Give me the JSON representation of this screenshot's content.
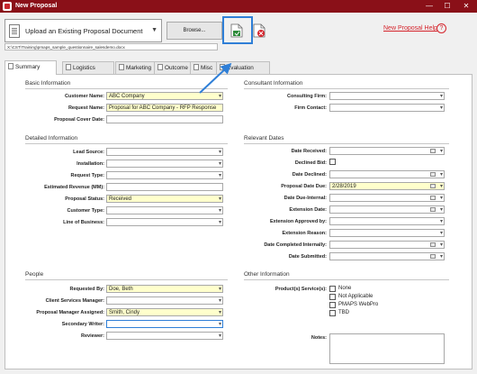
{
  "window": {
    "title": "New Proposal",
    "minimize": "—",
    "maximize": "☐",
    "close": "✕"
  },
  "toolbar": {
    "upload_select": "Upload an Existing Proposal Document",
    "browse_label": "Browse...",
    "file_path": "X:\\CST\\Training\\pmaps_sample_questionnaire_salesdemo.docx",
    "help_label": "New Proposal Help",
    "help_icon": "?"
  },
  "tabs": [
    {
      "label": "Summary",
      "active": true
    },
    {
      "label": "Logistics",
      "active": false
    },
    {
      "label": "Marketing",
      "active": false
    },
    {
      "label": "Outcome",
      "active": false
    },
    {
      "label": "Misc",
      "active": false
    },
    {
      "label": "Evaluation",
      "active": false
    }
  ],
  "basic_information": {
    "title": "Basic Information",
    "fields": [
      {
        "label": "Customer Name:",
        "value": "ABC Company"
      },
      {
        "label": "Request Name:",
        "value": "Proposal for ABC Company - RFP Response"
      },
      {
        "label": "Proposal Cover Date:",
        "value": ""
      }
    ]
  },
  "consultant_information": {
    "title": "Consultant Information",
    "fields": [
      {
        "label": "Consulting Firm:",
        "value": ""
      },
      {
        "label": "Firm Contact:",
        "value": ""
      }
    ]
  },
  "detailed_information": {
    "title": "Detailed Information",
    "fields": [
      {
        "label": "Lead Source:",
        "value": ""
      },
      {
        "label": "Installation:",
        "value": ""
      },
      {
        "label": "Request Type:",
        "value": ""
      },
      {
        "label": "Estimated Revenue (MM):",
        "value": ""
      },
      {
        "label": "Proposal Status:",
        "value": "Received"
      },
      {
        "label": "Customer Type:",
        "value": ""
      },
      {
        "label": "Line of Business:",
        "value": ""
      }
    ]
  },
  "relevant_dates": {
    "title": "Relevant Dates",
    "fields": [
      {
        "label": "Date Received:",
        "value": ""
      },
      {
        "label": "Declined Bid:",
        "value": ""
      },
      {
        "label": "Date Declined:",
        "value": ""
      },
      {
        "label": "Proposal Date Due:",
        "value": "2/28/2019"
      },
      {
        "label": "Date Due-Internal:",
        "value": ""
      },
      {
        "label": "Extension Date:",
        "value": ""
      },
      {
        "label": "Extension Approved by:",
        "value": ""
      },
      {
        "label": "Extension Reason:",
        "value": ""
      },
      {
        "label": "Date Completed Internally:",
        "value": ""
      },
      {
        "label": "Date Submitted:",
        "value": ""
      }
    ]
  },
  "people": {
    "title": "People",
    "fields": [
      {
        "label": "Requested By:",
        "value": "Doe, Beth"
      },
      {
        "label": "Client Services Manager:",
        "value": ""
      },
      {
        "label": "Proposal Manager Assigned:",
        "value": "Smith, Cindy"
      },
      {
        "label": "Secondary Writer:",
        "value": ""
      },
      {
        "label": "Reviewer:",
        "value": ""
      }
    ]
  },
  "other_information": {
    "title": "Other Information",
    "products_label": "Product(s) Service(s):",
    "products": [
      "None",
      "Not Applicable",
      "PMAPS WebPro",
      "TBD"
    ],
    "notes_label": "Notes:"
  },
  "colors": {
    "titlebar": "#8a1018",
    "highlight": "#2f7fd7",
    "required_field": "#ffffcc",
    "help_link": "#d5242c"
  }
}
